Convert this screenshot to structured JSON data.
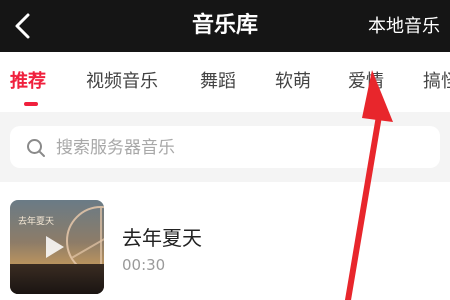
{
  "header": {
    "title": "音乐库",
    "local_music": "本地音乐"
  },
  "tabs": [
    {
      "label": "推荐",
      "active": true
    },
    {
      "label": "视频音乐",
      "active": false
    },
    {
      "label": "舞蹈",
      "active": false
    },
    {
      "label": "软萌",
      "active": false
    },
    {
      "label": "爱情",
      "active": false
    },
    {
      "label": "搞怪",
      "active": false
    }
  ],
  "search": {
    "placeholder": "搜索服务器音乐"
  },
  "songs": [
    {
      "title": "去年夏天",
      "duration": "00:30",
      "cover_text": "去年夏天"
    }
  ],
  "colors": {
    "accent": "#f0203d",
    "header_bg": "#151515",
    "annotation_arrow": "#e8262c"
  }
}
